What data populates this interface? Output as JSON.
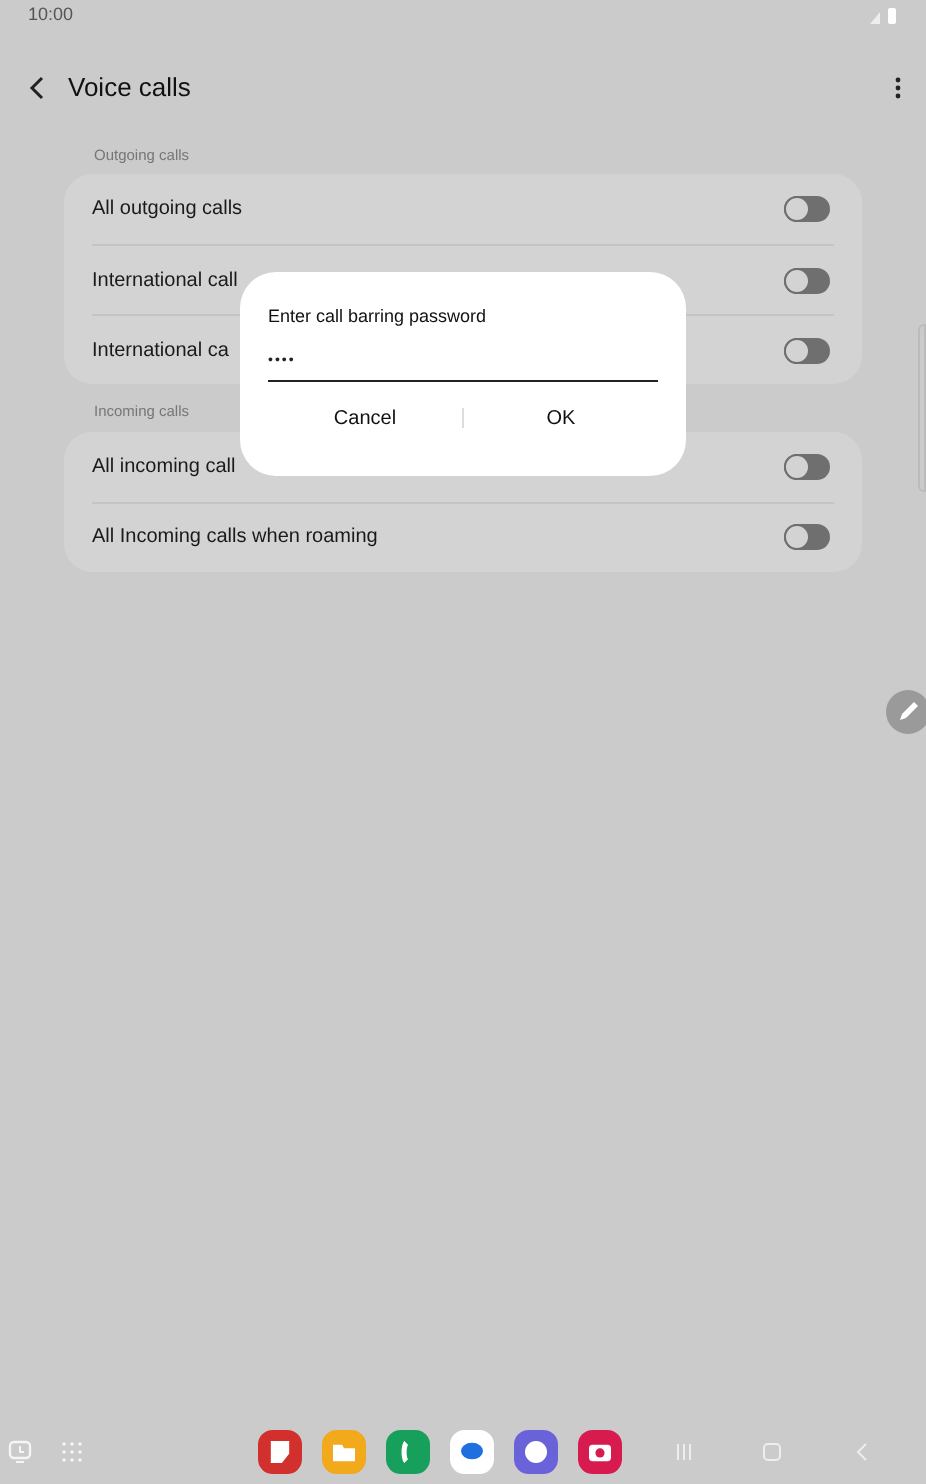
{
  "status_bar": {
    "time": "10:00"
  },
  "header": {
    "title": "Voice calls"
  },
  "sections": [
    {
      "title": "Outgoing calls",
      "rows": [
        {
          "label": "All outgoing calls",
          "on": false
        },
        {
          "label": "International call",
          "on": false
        },
        {
          "label": "International ca",
          "on": false
        }
      ]
    },
    {
      "title": "Incoming calls",
      "rows": [
        {
          "label": "All incoming call",
          "on": false
        },
        {
          "label": "All Incoming calls when roaming",
          "on": false
        }
      ]
    }
  ],
  "dialog": {
    "title": "Enter call barring password",
    "value": "••••",
    "buttons": [
      "Cancel",
      "OK"
    ]
  },
  "dock": {
    "apps": [
      {
        "color": "#d2302c"
      },
      {
        "color": "#f2a91c"
      },
      {
        "color": "#16a05c"
      },
      {
        "color": "#ffffff"
      },
      {
        "color": "#6a62d8"
      },
      {
        "color": "#d81b4f"
      }
    ]
  }
}
